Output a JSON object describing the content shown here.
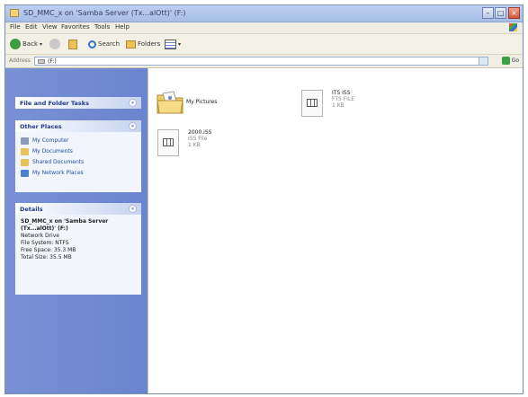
{
  "window": {
    "title": "SD_MMC_x on 'Samba Server (Tx...alOtt)' (F:)",
    "buttons": {
      "minimize": "–",
      "maximize": "□",
      "close": "×"
    }
  },
  "menu": [
    "File",
    "Edit",
    "View",
    "Favorites",
    "Tools",
    "Help"
  ],
  "toolbar": {
    "back": "Back",
    "search": "Search",
    "folders": "Folders"
  },
  "address": {
    "label": "Address",
    "value": "(F:)",
    "go": "Go"
  },
  "left_pane": {
    "tasks_title": "File and Folder Tasks",
    "other_places_title": "Other Places",
    "other_places": [
      {
        "label": "My Computer",
        "icon": "computer-icon",
        "color": "#8a9bb8"
      },
      {
        "label": "My Documents",
        "icon": "documents-folder-icon",
        "color": "#e9c25a"
      },
      {
        "label": "Shared Documents",
        "icon": "shared-folder-icon",
        "color": "#e9c25a"
      },
      {
        "label": "My Network Places",
        "icon": "network-icon",
        "color": "#4f7fd0"
      }
    ],
    "details_title": "Details",
    "details": {
      "name": "SD_MMC_x on 'Samba Server (Tx...alOtt)' (F:)",
      "type": "Network Drive",
      "file_system": "File System: NTFS",
      "free_space": "Free Space: 35.3 MB",
      "total_size": "Total Size: 35.5 MB"
    }
  },
  "files": [
    {
      "name": "My Pictures",
      "kind": "folder"
    },
    {
      "name": "ITS ISS",
      "line2": "FTS FILE",
      "line3": "1 KB",
      "kind": "document"
    },
    {
      "name": "2000.iSS",
      "line2": "ISS File",
      "line3": "1 KB",
      "kind": "document"
    }
  ],
  "colors": {
    "title_bar": "#a7bde6",
    "task_pane": "#6a84cf",
    "link": "#224da8",
    "close_button": "#d0553a"
  }
}
